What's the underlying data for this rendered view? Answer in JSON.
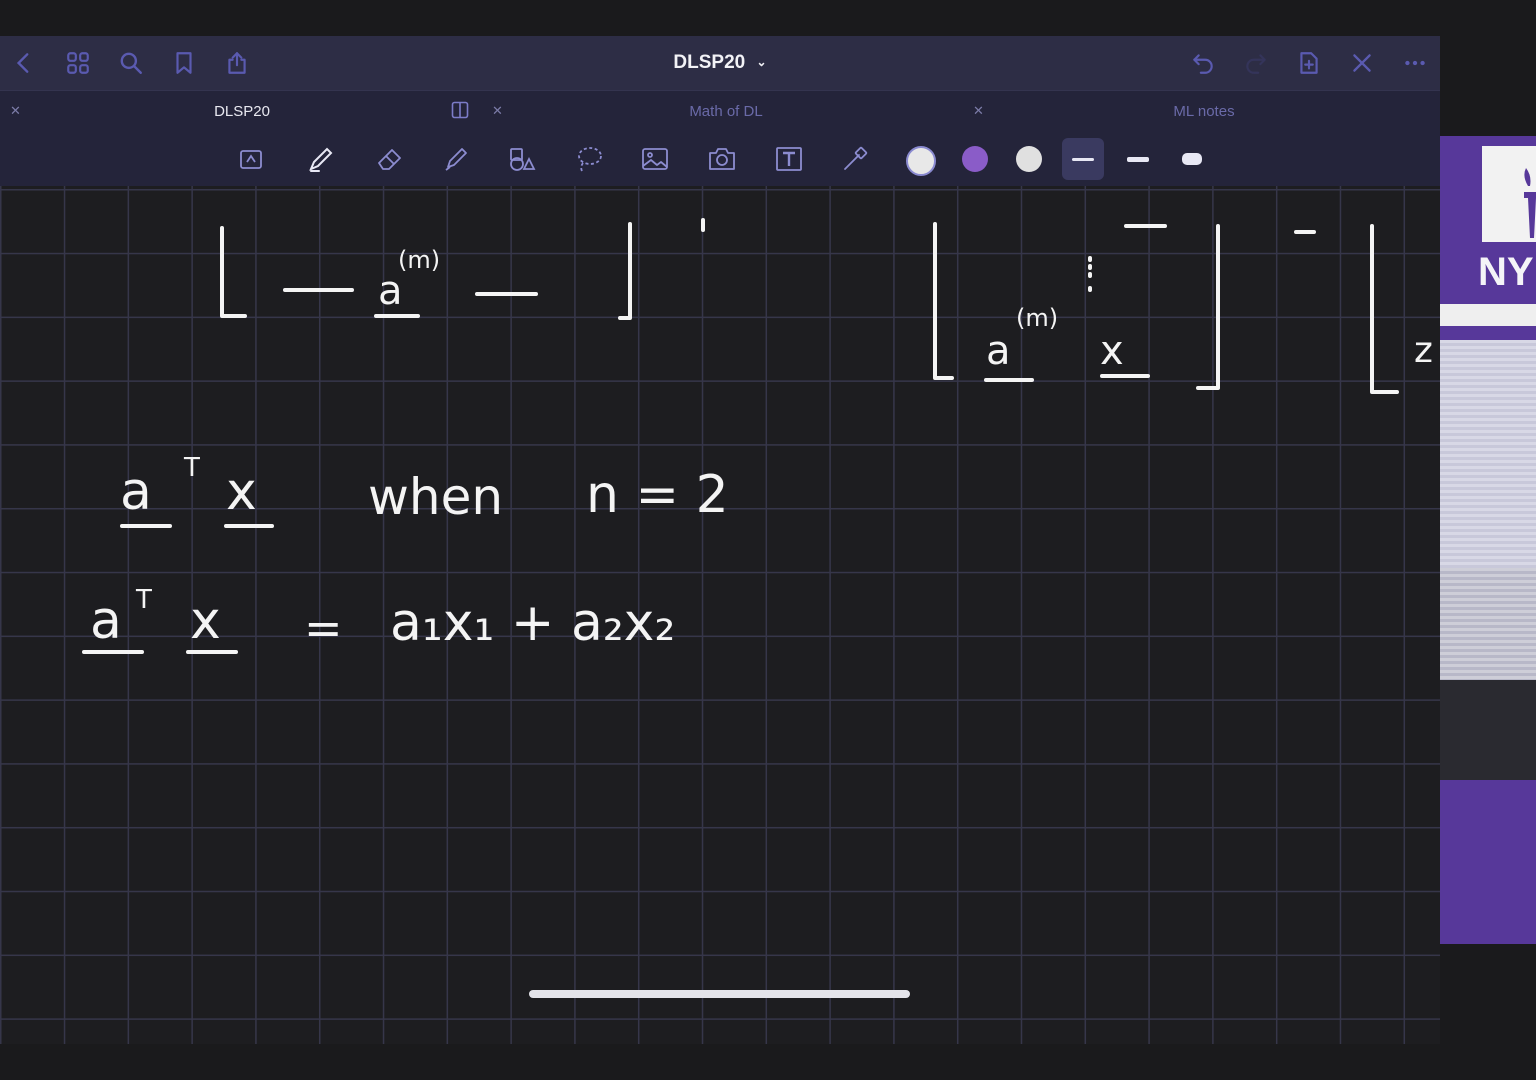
{
  "app": {
    "document_title": "DLSP20",
    "title_chevron": "chevron-down-icon"
  },
  "topbar": {
    "left_icons": [
      "back-icon",
      "grid-icon",
      "search-icon",
      "bookmark-icon",
      "share-icon"
    ],
    "right_icons": [
      "undo-icon",
      "redo-icon",
      "add-page-icon",
      "close-icon",
      "more-icon"
    ]
  },
  "tabs": [
    {
      "label": "DLSP20",
      "active": true
    },
    {
      "label": "Math of DL",
      "active": false
    },
    {
      "label": "ML notes",
      "active": false
    }
  ],
  "toolbar": {
    "tools": [
      "read-only-icon",
      "pen-icon",
      "eraser-icon",
      "highlighter-icon",
      "shapes-icon",
      "lasso-icon",
      "image-icon",
      "camera-icon",
      "text-tool-icon",
      "laser-pointer-icon"
    ],
    "colors": [
      "#e8e8e8",
      "#8a5cc8",
      "#e0e0e0"
    ],
    "selected_stroke_index": 0
  },
  "canvas_notes": {
    "line1_left": "a",
    "line1_left_sup": "T",
    "line1_var": "x",
    "line1_text": "when",
    "line1_cond": "n = 2",
    "line2_lhs_a": "a",
    "line2_lhs_sup": "T",
    "line2_lhs_x": "x",
    "line2_eq": "=",
    "line2_rhs": "a₁x₁ + a₂x₂",
    "top_left_row": "— a(m) —",
    "top_right_row": "a(m) x"
  },
  "side_panel": {
    "logo_text": "NY"
  }
}
